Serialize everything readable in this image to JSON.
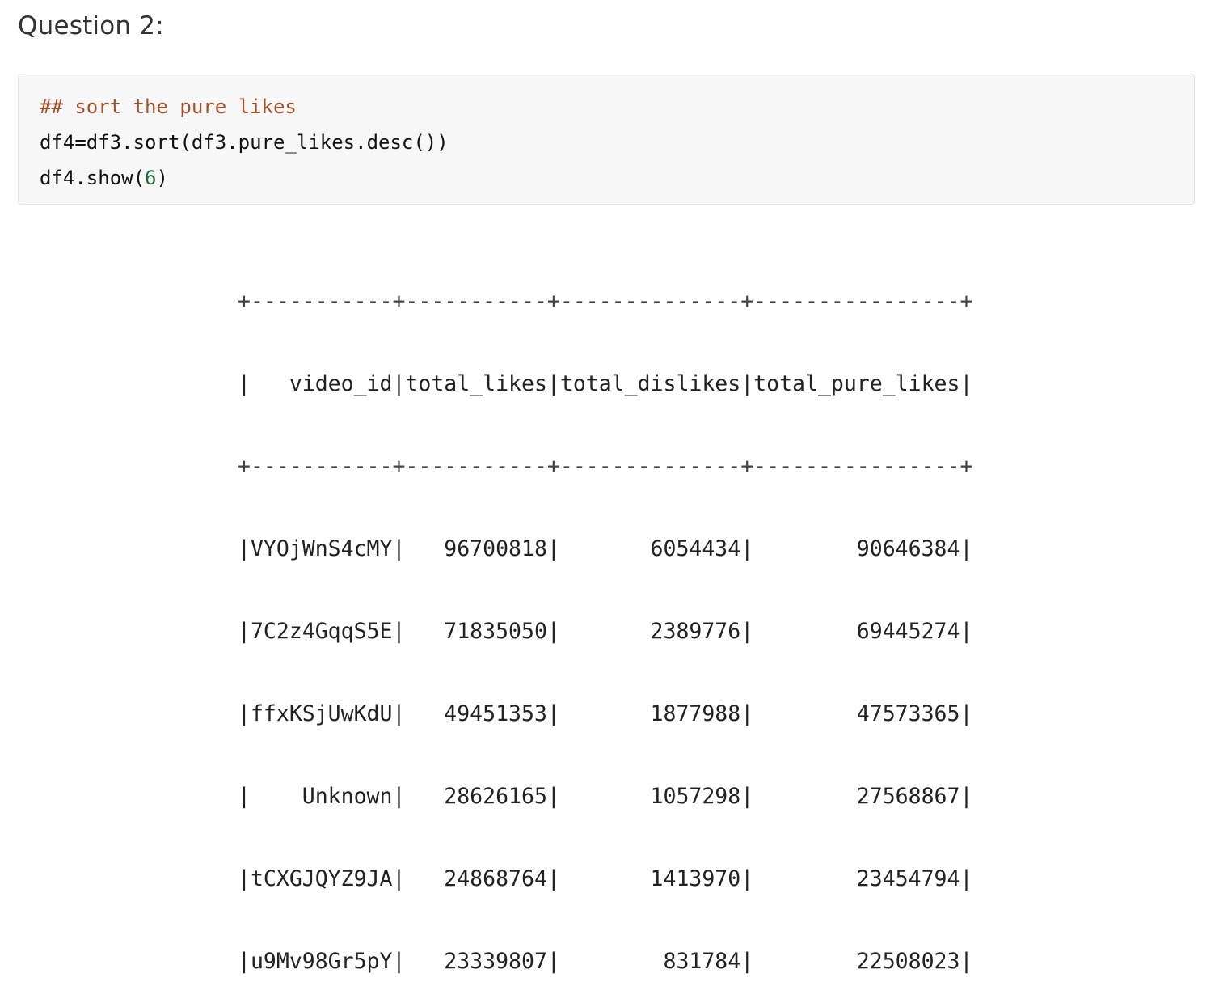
{
  "heading": "Question 2:",
  "code": {
    "comment": "## sort the pure likes",
    "line2": "df4=df3.sort(df3.pure_likes.desc())",
    "line3_prefix": "df4.show(",
    "line3_arg": "6",
    "line3_suffix": ")"
  },
  "output": {
    "border_top": "+-----------+-----------+--------------+----------------+",
    "header_row": "|   video_id|total_likes|total_dislikes|total_pure_likes|",
    "border_mid": "+-----------+-----------+--------------+----------------+",
    "columns": [
      "video_id",
      "total_likes",
      "total_dislikes",
      "total_pure_likes"
    ],
    "rows": [
      "|VYOjWnS4cMY|   96700818|       6054434|        90646384|",
      "|7C2z4GqqS5E|   71835050|       2389776|        69445274|",
      "|ffxKSjUwKdU|   49451353|       1877988|        47573365|",
      "|    Unknown|   28626165|       1057298|        27568867|",
      "|tCXGJQYZ9JA|   24868764|       1413970|        23454794|",
      "|u9Mv98Gr5pY|   23339807|        831784|        22508023|"
    ]
  }
}
